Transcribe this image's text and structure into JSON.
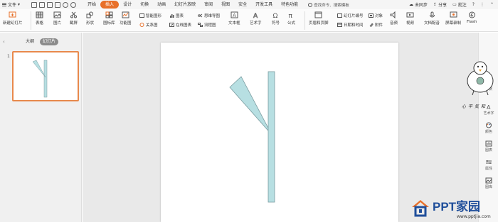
{
  "menubar": {
    "file_label": "文件",
    "tabs": [
      "开始",
      "插入",
      "设计",
      "切换",
      "动画",
      "幻灯片放映",
      "审阅",
      "视图",
      "安全",
      "开发工具",
      "特色功能"
    ],
    "active_tab": "插入",
    "search_text": "查找命令、搜索模板",
    "unsynced": "未同步",
    "share": "分享",
    "comment": "批注"
  },
  "ribbon": {
    "new_slide": "新建幻灯片",
    "table": "表格",
    "picture": "图片",
    "screenshot": "截屏",
    "shape": "形状",
    "icon_lib": "图标库",
    "function_chart": "功能图",
    "smart_graphic": "智能图形",
    "chart": "图表",
    "mind_map": "思维导图",
    "relation_chart": "关系图",
    "online_chart": "在线图表",
    "flowchart": "流程图",
    "textbox": "文本框",
    "art_text": "艺术字",
    "symbol": "符号",
    "formula": "公式",
    "header_footer": "页眉和页脚",
    "slide_number": "幻灯片编号",
    "object": "对象",
    "date_time": "日期和时间",
    "attachment": "附件",
    "audio": "音频",
    "video": "视频",
    "doc_dub": "文档配音",
    "screen_record": "屏幕录制",
    "flash": "Flash"
  },
  "panel": {
    "tab_outline": "大纲",
    "tab_slides": "幻灯片",
    "slide_number": "1"
  },
  "sidebar": {
    "items": [
      "形状",
      "艺术字",
      "颜色",
      "图表",
      "属性",
      "图库"
    ]
  },
  "stamp_text": "心平気和",
  "logo": {
    "title": "PPT家园",
    "url": "www.pptjia.com"
  },
  "colors": {
    "accent": "#e8702a",
    "shape_fill": "#b7dfe2",
    "shape_stroke": "#7a9ca0",
    "logo_blue": "#1f4e9a",
    "logo_orange": "#e8702a"
  }
}
